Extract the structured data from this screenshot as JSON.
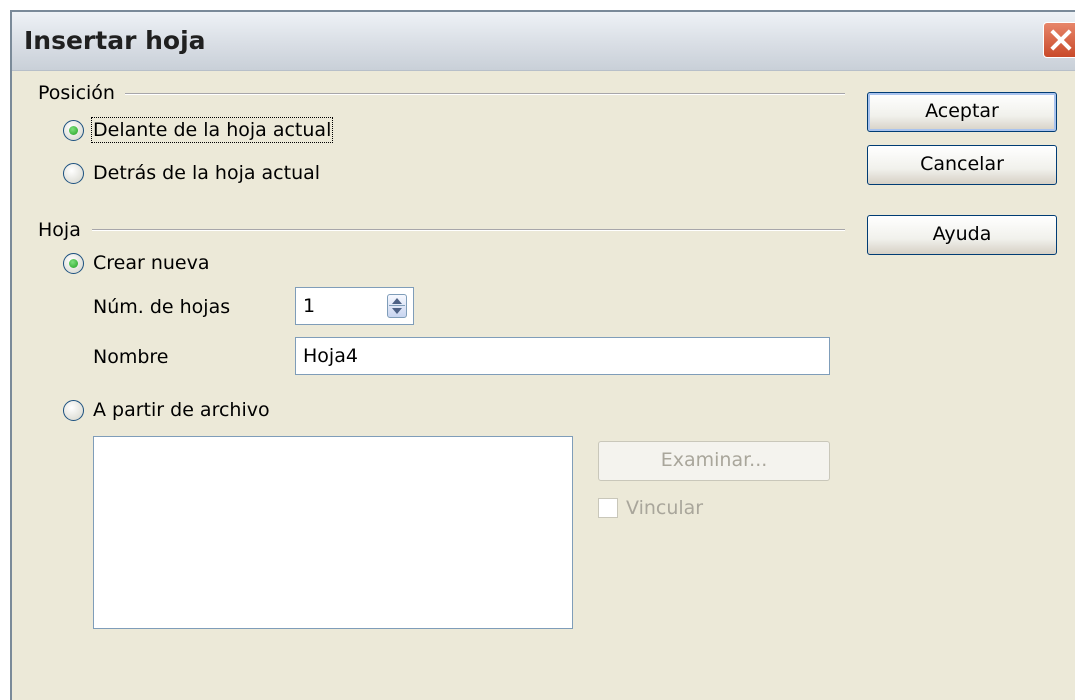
{
  "dialog": {
    "title": "Insertar hoja"
  },
  "position": {
    "label": "Posición",
    "before": {
      "label": "Delante de la hoja actual",
      "selected": true
    },
    "after": {
      "label": "Detrás de la hoja actual",
      "selected": false
    }
  },
  "sheet": {
    "label": "Hoja",
    "create_new": {
      "label": "Crear nueva",
      "selected": true
    },
    "num_sheets": {
      "label": "Núm. de hojas",
      "value": "1"
    },
    "name": {
      "label": "Nombre",
      "value": "Hoja4"
    },
    "from_file": {
      "label": "A partir de archivo",
      "selected": false
    },
    "browse_label": "Examinar...",
    "link_label": "Vincular"
  },
  "buttons": {
    "ok": "Aceptar",
    "cancel": "Cancelar",
    "help": "Ayuda"
  },
  "icons": {
    "close": "close-icon",
    "spin": "spin-arrows-icon"
  }
}
